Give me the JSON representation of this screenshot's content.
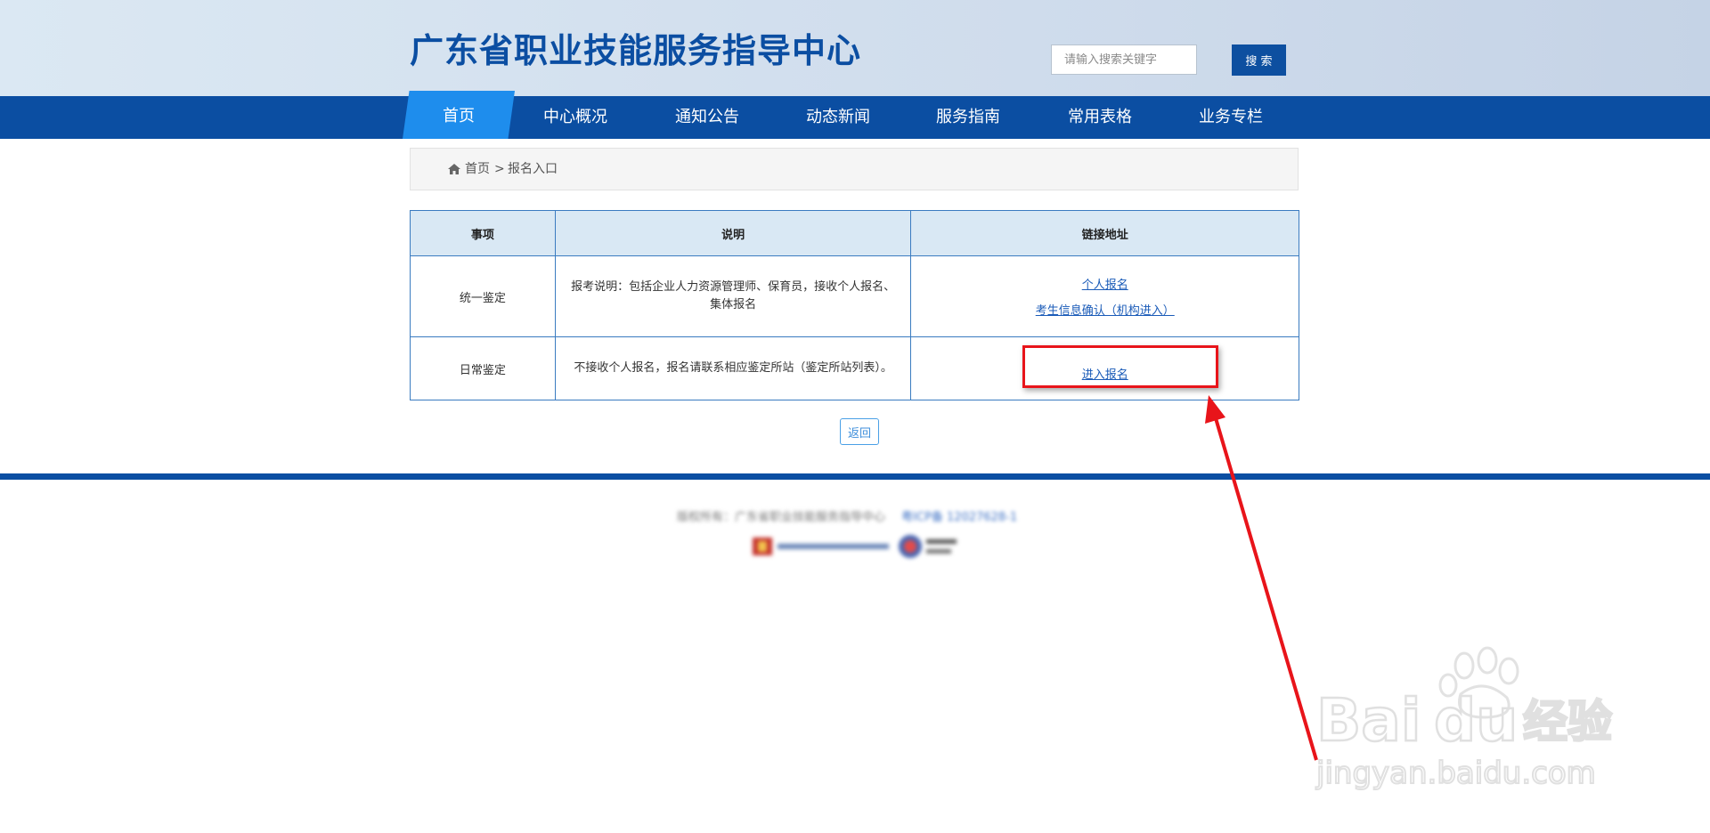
{
  "header": {
    "site_title": "广东省职业技能服务指导中心",
    "search_placeholder": "请输入搜索关键字",
    "search_button": "搜 索"
  },
  "nav": {
    "items": [
      {
        "label": "首页",
        "active": true
      },
      {
        "label": "中心概况"
      },
      {
        "label": "通知公告"
      },
      {
        "label": "动态新闻"
      },
      {
        "label": "服务指南"
      },
      {
        "label": "常用表格"
      },
      {
        "label": "业务专栏"
      }
    ]
  },
  "breadcrumb": {
    "home": "首页",
    "separator": ">",
    "current": "报名入口"
  },
  "table": {
    "headers": [
      "事项",
      "说明",
      "链接地址"
    ],
    "rows": [
      {
        "item": "统一鉴定",
        "desc": "报考说明：包括企业人力资源管理师、保育员，接收个人报名、集体报名",
        "links": [
          "个人报名",
          "考生信息确认（机构进入）"
        ]
      },
      {
        "item": "日常鉴定",
        "desc": "不接收个人报名，报名请联系相应鉴定所站（鉴定所站列表）。",
        "links": [
          "进入报名"
        ]
      }
    ]
  },
  "back_button": "返回",
  "footer": {
    "copyright": "版权所有：广东省职业技能服务指导中心",
    "icp": "粤ICP备 12027628-1"
  },
  "annotation": {
    "color": "#e8141a",
    "highlighted_link": "进入报名"
  },
  "watermark": {
    "brand": "Baidu经验",
    "url": "jingyan.baidu.com"
  },
  "colors": {
    "brand_blue": "#0b4ea2",
    "nav_active": "#1e8ded",
    "table_header_bg": "#d9e8f4",
    "link": "#1a5bb8"
  }
}
